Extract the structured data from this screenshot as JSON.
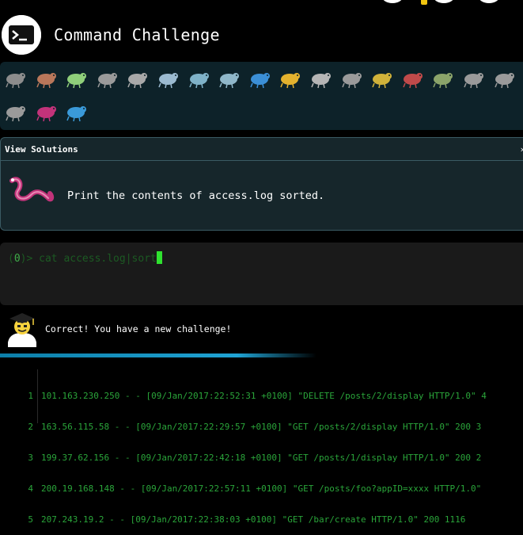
{
  "app": {
    "title": "Command Challenge",
    "logo_icon": "terminal-prompt-icon"
  },
  "creatures": [
    "snail-icon",
    "butterfly-icon",
    "caterpillar-icon",
    "bug-icon",
    "germ-icon",
    "whale-icon",
    "dolphin-icon",
    "dolphin2-icon",
    "fish-icon",
    "tropical-fish-icon",
    "pufferfish-icon",
    "cat-icon",
    "bee-icon",
    "ladybug-icon",
    "grasshopper-icon",
    "spider-icon",
    "ant-icon",
    "fly-icon",
    "worm-icon",
    "paramecium-icon"
  ],
  "solutions": {
    "label": "View Solutions",
    "toggle": "›"
  },
  "challenge": {
    "icon": "worm-icon",
    "text": "Print the contents of access.log sorted."
  },
  "terminal": {
    "prompt_open": "(",
    "prompt_count": "0",
    "prompt_close": ")> ",
    "command": "cat access.log|sort"
  },
  "result": {
    "icon": "graduate-icon",
    "message": "Correct! You have a new challenge!"
  },
  "output": [
    {
      "n": "1",
      "text": "101.163.230.250 - - [09/Jan/2017:22:52:31 +0100] \"DELETE /posts/2/display HTTP/1.0\" 4"
    },
    {
      "n": "2",
      "text": "163.56.115.58 - - [09/Jan/2017:22:29:57 +0100] \"GET /posts/2/display HTTP/1.0\" 200 3"
    },
    {
      "n": "3",
      "text": "199.37.62.156 - - [09/Jan/2017:22:42:18 +0100] \"GET /posts/1/display HTTP/1.0\" 200 2"
    },
    {
      "n": "4",
      "text": "200.19.168.148 - - [09/Jan/2017:22:57:11 +0100] \"GET /posts/foo?appID=xxxx HTTP/1.0\""
    },
    {
      "n": "5",
      "text": "207.243.19.2 - - [09/Jan/2017:22:38:03 +0100] \"GET /bar/create HTTP/1.0\" 200 1116"
    }
  ],
  "colors": {
    "panel": "#0d2229",
    "terminal": "#1a1a1a",
    "prompt_green": "#1c5a23",
    "cursor_green": "#2fe12f",
    "output_green": "#2aa53a",
    "accent_blue": "#1fa3d4"
  }
}
